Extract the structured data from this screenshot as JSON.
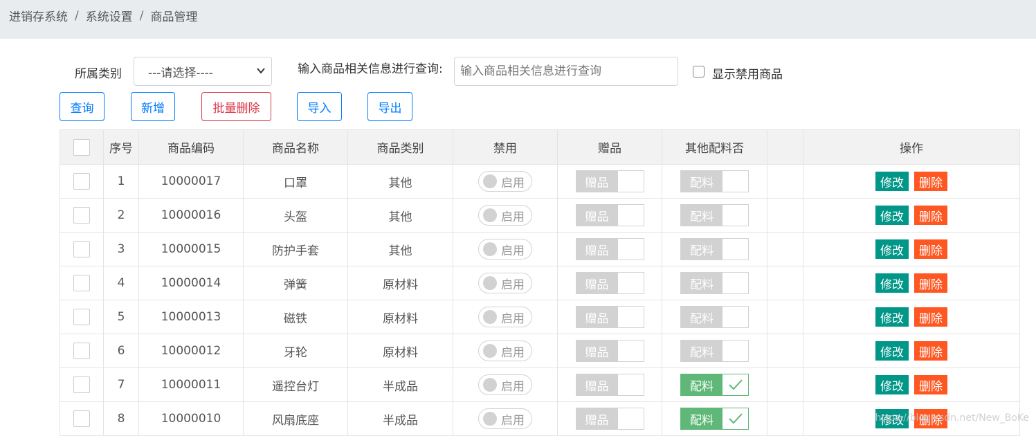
{
  "breadcrumb": [
    "进销存系统",
    "系统设置",
    "商品管理"
  ],
  "filters": {
    "category_label": "所属类别",
    "category_selected": "---请选择----",
    "search_label": "输入商品相关信息进行查询:",
    "search_placeholder": "输入商品相关信息进行查询",
    "show_disabled_label": "显示禁用商品"
  },
  "buttons": {
    "query": "查询",
    "add": "新增",
    "batch_delete": "批量删除",
    "import": "导入",
    "export": "导出"
  },
  "table": {
    "headers": [
      "序号",
      "商品编码",
      "商品名称",
      "商品类别",
      "禁用",
      "赠品",
      "其他配料否",
      "",
      "操作"
    ],
    "switch_label": "启用",
    "gift_label": "赠品",
    "ingredient_label": "配料",
    "edit_label": "修改",
    "delete_label": "删除",
    "rows": [
      {
        "no": "1",
        "code": "10000017",
        "name": "口罩",
        "category": "其他",
        "ingredient_checked": false
      },
      {
        "no": "2",
        "code": "10000016",
        "name": "头盔",
        "category": "其他",
        "ingredient_checked": false
      },
      {
        "no": "3",
        "code": "10000015",
        "name": "防护手套",
        "category": "其他",
        "ingredient_checked": false
      },
      {
        "no": "4",
        "code": "10000014",
        "name": "弹簧",
        "category": "原材料",
        "ingredient_checked": false
      },
      {
        "no": "5",
        "code": "10000013",
        "name": "磁铁",
        "category": "原材料",
        "ingredient_checked": false
      },
      {
        "no": "6",
        "code": "10000012",
        "name": "牙轮",
        "category": "原材料",
        "ingredient_checked": false
      },
      {
        "no": "7",
        "code": "10000011",
        "name": "遥控台灯",
        "category": "半成品",
        "ingredient_checked": true
      },
      {
        "no": "8",
        "code": "10000010",
        "name": "风扇底座",
        "category": "半成品",
        "ingredient_checked": true
      }
    ]
  },
  "watermark": "https://blog.csdn.net/New_BoKe",
  "colors": {
    "edit": "#009688",
    "delete": "#ff5722",
    "ingredient_on": "#5fb878"
  }
}
